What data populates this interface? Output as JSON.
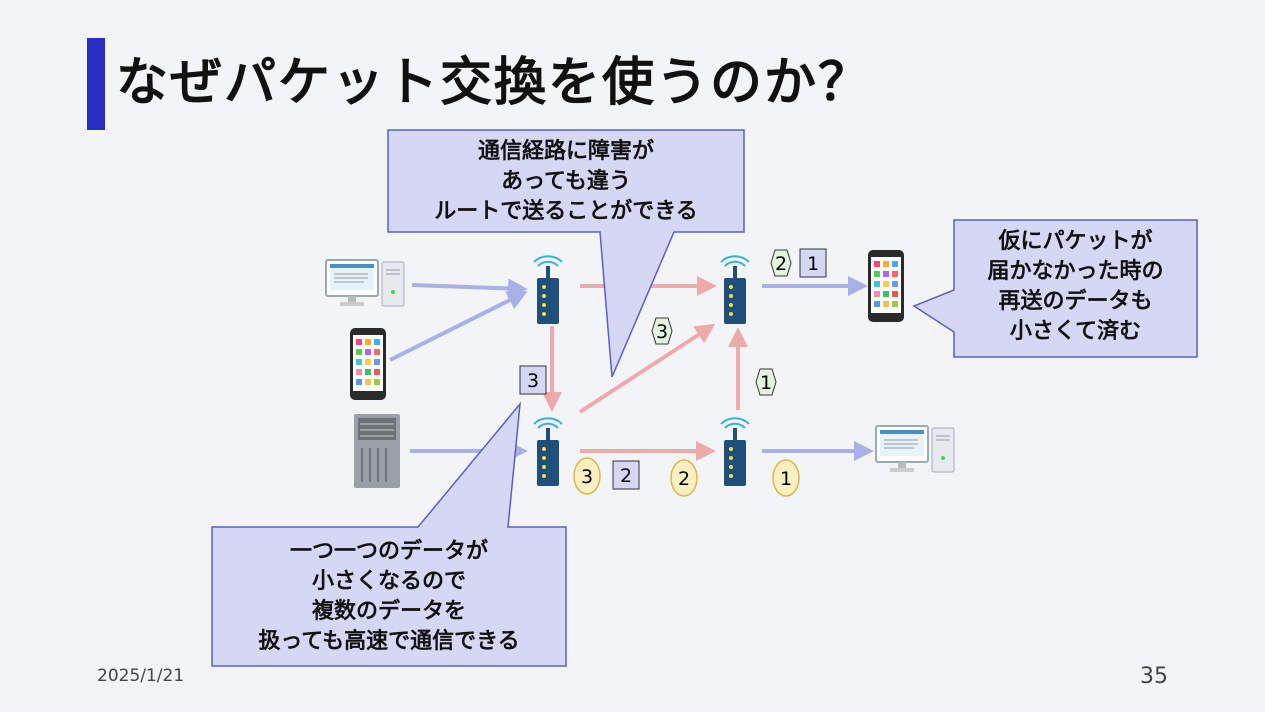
{
  "title": "なぜパケット交換を使うのか？",
  "callouts": {
    "top": [
      "通信経路に障害が",
      "あっても違う",
      "ルートで送ることができる"
    ],
    "right": [
      "仮にパケットが",
      "届かなかった時の",
      "再送のデータも",
      "小さくて済む"
    ],
    "bottom": [
      "一つ一つのデータが",
      "小さくなるので",
      "複数のデータを",
      "扱っても高速で通信できる"
    ]
  },
  "packets": {
    "square_top_1": "1",
    "hex_top_2": "2",
    "hex_mid_3": "3",
    "hex_right_1": "1",
    "square_left_3": "3",
    "square_bottom_2": "2",
    "circle_bottom_3": "3",
    "circle_bottom_2": "2",
    "circle_bottom_1": "1"
  },
  "colors": {
    "title_accent": "#2a2fc4",
    "callout_fill": "#d6d7f4",
    "callout_stroke": "#5a5ec8",
    "link_blue": "#aab0e6",
    "link_red": "#eeaaaa",
    "hex_fill": "#e4f4dc",
    "circle_fill": "#fbeec0"
  },
  "footer": {
    "date": "2025/1/21",
    "page": "35"
  }
}
